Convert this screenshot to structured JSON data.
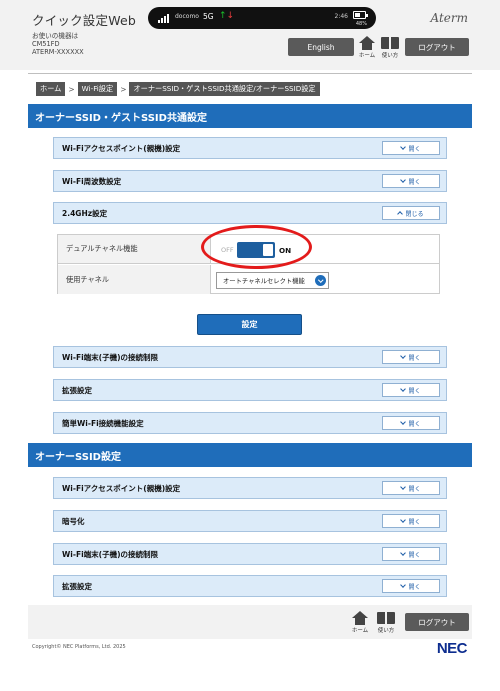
{
  "header": {
    "app_title": "クイック設定Web",
    "device_label": "お使いの機器は",
    "device_model": "CM51FD",
    "device_id": "ATERM-XXXXXX",
    "brand": "Aterm",
    "english_label": "English",
    "home_label": "ホーム",
    "manual_label": "使い方",
    "logout_label": "ログアウト"
  },
  "status_bar": {
    "carrier": "docomo",
    "network": "5G",
    "time": "2:46",
    "battery": "48%"
  },
  "breadcrumb": [
    "ホーム",
    "Wi-Fi設定",
    "オーナーSSID・ゲストSSID共通設定/オーナーSSID設定"
  ],
  "section_common": {
    "title": "オーナーSSID・ゲストSSID共通設定",
    "rows": [
      {
        "label": "Wi-Fiアクセスポイント(親機)設定",
        "button": "開く"
      },
      {
        "label": "Wi-Fi周波数設定",
        "button": "開く"
      },
      {
        "label": "2.4GHz設定",
        "button": "閉じる"
      }
    ],
    "dual_channel_label": "デュアルチャネル機能",
    "toggle_off": "OFF",
    "toggle_on": "ON",
    "toggle_state": "on",
    "channel_label": "使用チャネル",
    "channel_value": "オートチャネルセレクト機能",
    "set_button": "設定",
    "rows_after": [
      {
        "label": "Wi-Fi端末(子機)の接続制限",
        "button": "開く"
      },
      {
        "label": "拡張設定",
        "button": "開く"
      },
      {
        "label": "簡単Wi-Fi接続機能設定",
        "button": "開く"
      }
    ]
  },
  "section_owner": {
    "title": "オーナーSSID設定",
    "rows": [
      {
        "label": "Wi-Fiアクセスポイント(親機)設定",
        "button": "開く"
      },
      {
        "label": "暗号化",
        "button": "開く"
      },
      {
        "label": "Wi-Fi端末(子機)の接続制限",
        "button": "開く"
      },
      {
        "label": "拡張設定",
        "button": "開く"
      }
    ]
  },
  "footer": {
    "copyright": "Copyright© NEC Platforms, Ltd. 2025",
    "logo": "NEC"
  },
  "colors": {
    "accent": "#1f6dba",
    "row_background": "#dcebf9",
    "highlight": "#e31b1b",
    "header_background": "#f2f2f2"
  }
}
